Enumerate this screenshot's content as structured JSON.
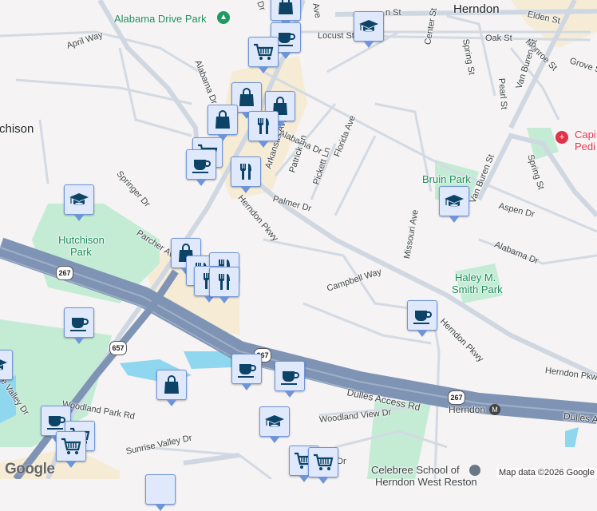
{
  "map": {
    "places": {
      "herndon": "Herndon",
      "hutchison_partial": "chison",
      "alabama_drive_park": "Alabama Drive Park",
      "hutchison_park_1": "Hutchison",
      "hutchison_park_2": "Park",
      "bruin_park": "Bruin Park",
      "haley_park_1": "Haley M.",
      "haley_park_2": "Smith Park",
      "capital_pedi_1": "Capi",
      "capital_pedi_2": "Pedi",
      "celebree_1": "Celebree School of",
      "celebree_2": "Herndon West Reston",
      "herndon_metro": "Herndon"
    },
    "streets": {
      "april_way": "April Way",
      "alabama_dr_n": "Alabama Dr",
      "alabama_dr_mid": "Alabama Dr",
      "alabama_dr_se": "Alabama Dr",
      "springer_dr": "Springer Dr",
      "parcher_ave": "Parcher Ave",
      "herndon_pkwy_w": "Herndon Pkwy",
      "herndon_pkwy_mid": "Herndon Pkwy",
      "herndon_pkwy_e": "Herndon Pkwy",
      "arkansas_ave": "Arkansas Ave",
      "patrick_ln": "Patrick Ln",
      "pickett_ln": "Pickett Ln",
      "palmer_dr": "Palmer Dr",
      "florida_ave": "Florida Ave",
      "center_st": "Center St",
      "spring_st_n": "Spring St",
      "spring_st_s": "Spring St",
      "oak_st": "Oak St",
      "locust_st": "Locust St",
      "elden_st_w": "n St",
      "elden_st": "Elden St",
      "monroe_st": "Monroe St",
      "grove_st": "Grove S",
      "pearl_st": "Pearl St",
      "van_buren_n": "Van Buren St",
      "van_buren_s": "Van Buren St",
      "aspen_dr": "Aspen Dr",
      "missouri_ave": "Missouri Ave",
      "campbell_way": "Campbell Way",
      "dulles_access": "Dulles Access Rd",
      "dulles_access_e": "Dulles A",
      "woodland_park": "Woodland Park Rd",
      "woodland_view": "Woodland View Dr",
      "sunrise_valley": "Sunrise Valley Dr",
      "sunrise_valley_w": "se Valley Dr",
      "sunrise_partial": "t Dr",
      "top_dr": "Dr",
      "top_ave": "Ave"
    },
    "shields": [
      "267",
      "267",
      "267",
      "657"
    ],
    "attribution": "Map data ©2026 Google",
    "logo": "Google"
  },
  "colors": {
    "highway": "#7f94b5",
    "park": "#c4ecd5",
    "commercial": "#f6ecd6",
    "water": "#8fd6ef",
    "marker_fill": "#dfe9fb",
    "marker_icon": "#0c4366"
  },
  "markers": [
    "shopping-bag",
    "coffee",
    "shopping-cart",
    "shopping-bag",
    "shopping-bag",
    "shopping-bag",
    "restaurant",
    "shopping-cart",
    "coffee",
    "restaurant",
    "school",
    "school",
    "school",
    "coffee",
    "shopping-bag",
    "restaurant",
    "restaurant",
    "coffee",
    "school",
    "coffee",
    "coffee",
    "shopping-bag",
    "coffee",
    "shopping-cart",
    "shopping-cart",
    "school",
    "shopping-cart",
    "shopping-cart"
  ]
}
